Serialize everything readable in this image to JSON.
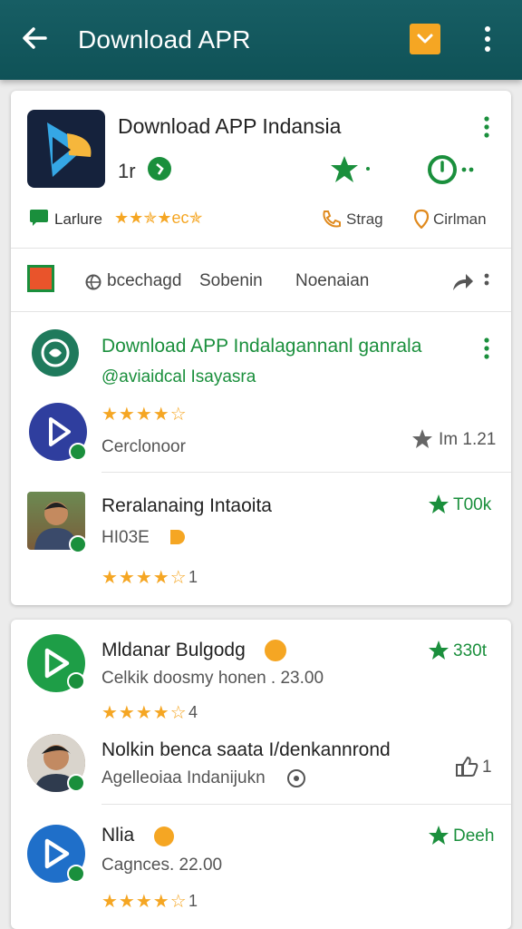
{
  "appbar": {
    "title": "Download APR"
  },
  "header_card": {
    "app_name": "Download APP Indansia",
    "stat_left": "1r",
    "tag_label": "Larlure",
    "tag_stars": "★★✯★ec✯",
    "link1": "Strag",
    "link2": "Cirlman"
  },
  "tabs": {
    "tab1": "bcechagd",
    "tab2": "Sobenin",
    "tab3": "Noenaian"
  },
  "feature": {
    "title": "Download APP Indalagannanl  ganrala",
    "subtitle": "@aviaidcal Isayasra"
  },
  "items_card1": [
    {
      "name": "",
      "stars": "★★★★☆",
      "sub": "Cerclonoor",
      "meta": "Im 1.21"
    },
    {
      "name": "Reralanaing Intaoita",
      "sub": "HI03E",
      "stars": "★★★★☆",
      "count": "1",
      "meta": "T00k"
    }
  ],
  "items_card2": [
    {
      "name": "Mldanar Bulgodg",
      "sub": "Celkik  doosmy honen . 23.00",
      "stars": "★★★★☆",
      "count": "4",
      "meta": "330t"
    },
    {
      "name": "Nolkin benca saata I/denkannrond",
      "sub": "Agelleoiaa  Indanijukn",
      "meta": "1"
    },
    {
      "name": "Nlia",
      "sub": "Cagnces. 22.00",
      "stars": "★★★★☆",
      "count": "1",
      "meta": "Deeh"
    }
  ],
  "colors": {
    "appbar": "#175e64",
    "accent_green": "#1a8f3c",
    "star": "#f5a623",
    "bookmark": "#f5a623"
  }
}
